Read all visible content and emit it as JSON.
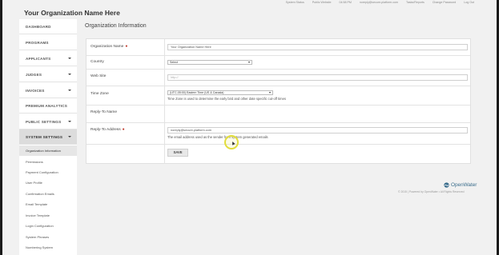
{
  "top_links": [
    "System Status",
    "Public Website",
    "04:58 PM",
    "noreply@secure-platform.com",
    "Tasks/Reports",
    "Change Password",
    "Log Out"
  ],
  "org_name": "Your Organization Name Here",
  "nav": {
    "dashboard": "DASHBOARD",
    "programs": "PROGRAMS",
    "applicants": "APPLICANTS",
    "judges": "JUDGES",
    "invoices": "INVOICES",
    "premium_analytics": "PREMIUM ANALYTICS",
    "public_settings": "PUBLIC SETTINGS",
    "system_settings": "SYSTEM SETTINGS"
  },
  "sub_nav": [
    "Organization Information",
    "Permissions",
    "Payment Configuration",
    "User Profile",
    "Confirmation Emails",
    "Email Template",
    "Invoice Template",
    "Login Configuration",
    "System Phrases",
    "Numbering System"
  ],
  "page_title": "Organization Information",
  "form": {
    "org_name_label": "Organization Name",
    "org_name_value": "Your Organization Name Here",
    "country_label": "Country",
    "country_value": "Select",
    "website_label": "Web Site",
    "website_placeholder": "http://",
    "timezone_label": "Time Zone",
    "timezone_value": "(UTC-05:00) Eastern Time (US & Canada)",
    "timezone_hint": "Time Zone is used to determine the early bird and other date specific cut-off times",
    "reply_name_label": "Reply-To Name",
    "reply_name_value": "",
    "reply_addr_label": "Reply-To Address",
    "reply_addr_value": "noreply@secure-platform.com",
    "reply_addr_hint": "The email address used as the sender from system generated emails",
    "save_label": "SAVE"
  },
  "footer": {
    "brand": "OpenWater",
    "copyright": "© 2015 | Powered by OpenWater • All Rights Reserved"
  },
  "colors": {
    "accent": "#3a6d8c",
    "required": "#c0392b"
  }
}
